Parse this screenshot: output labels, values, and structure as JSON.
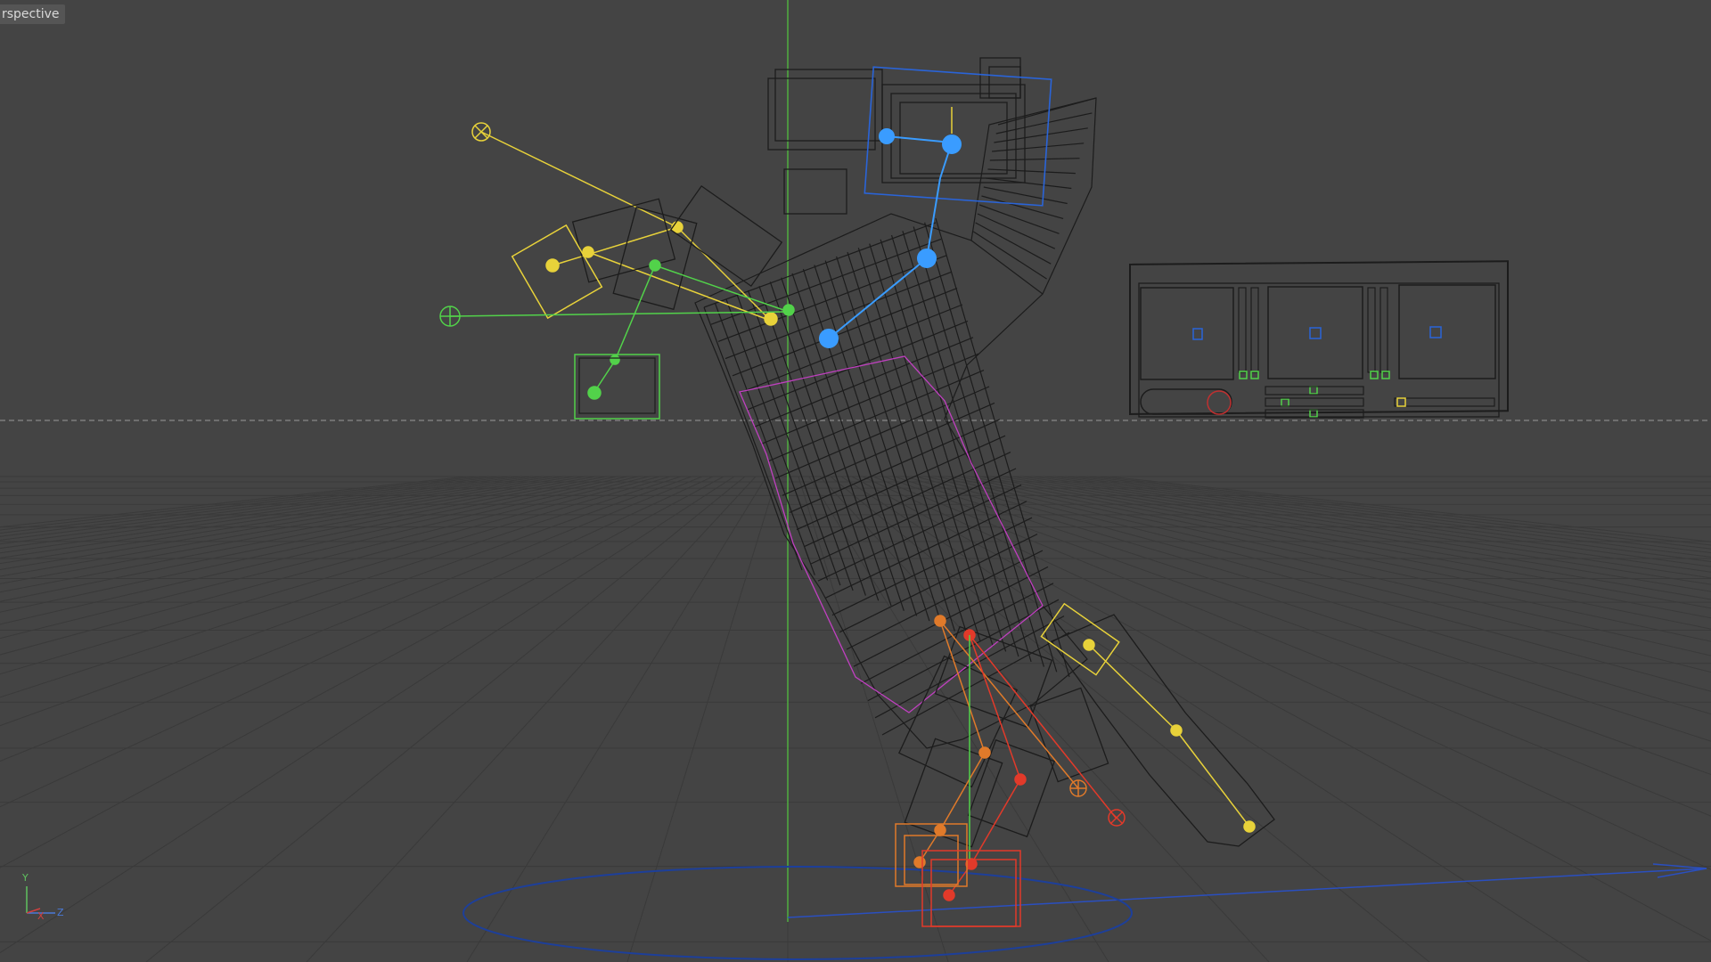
{
  "viewport": {
    "label": "rspective",
    "background": "#444444",
    "grid_color": "#3a3a3a",
    "horizon_line_color": "#9a9a9a"
  },
  "axis_indicator": {
    "y_label": "Y",
    "x_label": "X",
    "z_label": "Z",
    "y_color": "#5fc15f",
    "x_color": "#d04040",
    "z_color": "#4a7ad8"
  },
  "rig": {
    "mesh_color": "#1c1c1c",
    "left_arm_color": "#e8d23a",
    "right_arm_color": "#52d24a",
    "spine_color": "#3a9cff",
    "leg_right_color": "#e23a2a",
    "leg_left_color": "#e07a2a",
    "root_circle_color": "#1d3f9a",
    "selection_color": "#c040c0"
  },
  "control_panel": {
    "slot_color": "#2a64d8",
    "green_handle_color": "#52d24a",
    "yellow_handle_color": "#e8d23a",
    "red_circle_color": "#c03030"
  }
}
